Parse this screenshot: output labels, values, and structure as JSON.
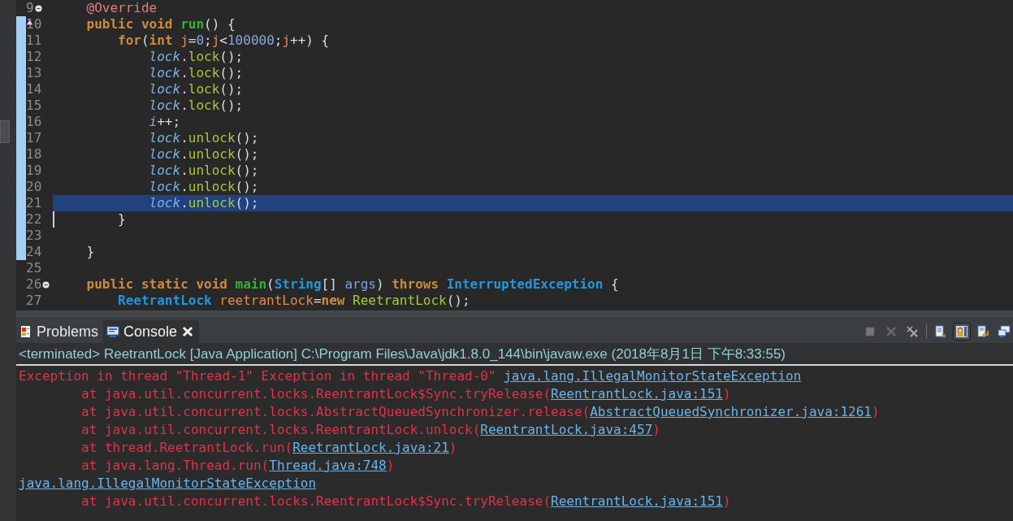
{
  "editor": {
    "lines": [
      {
        "number": "9",
        "changed": false,
        "current": false,
        "cursor": false,
        "fold": true,
        "override": false,
        "tokens": [
          {
            "kind": "annotation",
            "text": "    @Override"
          }
        ]
      },
      {
        "number": "10",
        "changed": true,
        "current": false,
        "cursor": false,
        "fold": false,
        "override": true,
        "tokens": [
          {
            "kind": "keyword",
            "text": "    public void "
          },
          {
            "kind": "declaration",
            "text": "run"
          },
          {
            "kind": "plain",
            "text": "() {"
          }
        ]
      },
      {
        "number": "11",
        "changed": true,
        "current": false,
        "cursor": false,
        "fold": false,
        "override": false,
        "tokens": [
          {
            "kind": "keyword",
            "text": "        for"
          },
          {
            "kind": "plain",
            "text": "("
          },
          {
            "kind": "keyword",
            "text": "int "
          },
          {
            "kind": "local",
            "text": "j"
          },
          {
            "kind": "plain",
            "text": "="
          },
          {
            "kind": "number",
            "text": "0"
          },
          {
            "kind": "plain",
            "text": ";"
          },
          {
            "kind": "local",
            "text": "j"
          },
          {
            "kind": "plain",
            "text": "<"
          },
          {
            "kind": "number",
            "text": "100000"
          },
          {
            "kind": "plain",
            "text": ";"
          },
          {
            "kind": "local",
            "text": "j"
          },
          {
            "kind": "plain",
            "text": "++) {"
          }
        ]
      },
      {
        "number": "12",
        "changed": true,
        "current": false,
        "cursor": false,
        "fold": false,
        "override": false,
        "tokens": [
          {
            "kind": "field",
            "text": "            lock"
          },
          {
            "kind": "plain",
            "text": "."
          },
          {
            "kind": "call",
            "text": "lock"
          },
          {
            "kind": "plain",
            "text": "();"
          }
        ]
      },
      {
        "number": "13",
        "changed": true,
        "current": false,
        "cursor": false,
        "fold": false,
        "override": false,
        "tokens": [
          {
            "kind": "field",
            "text": "            lock"
          },
          {
            "kind": "plain",
            "text": "."
          },
          {
            "kind": "call",
            "text": "lock"
          },
          {
            "kind": "plain",
            "text": "();"
          }
        ]
      },
      {
        "number": "14",
        "changed": true,
        "current": false,
        "cursor": false,
        "fold": false,
        "override": false,
        "tokens": [
          {
            "kind": "field",
            "text": "            lock"
          },
          {
            "kind": "plain",
            "text": "."
          },
          {
            "kind": "call",
            "text": "lock"
          },
          {
            "kind": "plain",
            "text": "();"
          }
        ]
      },
      {
        "number": "15",
        "changed": true,
        "current": false,
        "cursor": false,
        "fold": false,
        "override": false,
        "tokens": [
          {
            "kind": "field",
            "text": "            lock"
          },
          {
            "kind": "plain",
            "text": "."
          },
          {
            "kind": "call",
            "text": "lock"
          },
          {
            "kind": "plain",
            "text": "();"
          }
        ]
      },
      {
        "number": "16",
        "changed": true,
        "current": false,
        "cursor": false,
        "fold": false,
        "override": false,
        "tokens": [
          {
            "kind": "field",
            "text": "            i"
          },
          {
            "kind": "plain",
            "text": "++;"
          }
        ]
      },
      {
        "number": "17",
        "changed": true,
        "current": false,
        "cursor": false,
        "fold": false,
        "override": false,
        "tokens": [
          {
            "kind": "field",
            "text": "            lock"
          },
          {
            "kind": "plain",
            "text": "."
          },
          {
            "kind": "call",
            "text": "unlock"
          },
          {
            "kind": "plain",
            "text": "();"
          }
        ]
      },
      {
        "number": "18",
        "changed": true,
        "current": false,
        "cursor": false,
        "fold": false,
        "override": false,
        "tokens": [
          {
            "kind": "field",
            "text": "            lock"
          },
          {
            "kind": "plain",
            "text": "."
          },
          {
            "kind": "call",
            "text": "unlock"
          },
          {
            "kind": "plain",
            "text": "();"
          }
        ]
      },
      {
        "number": "19",
        "changed": true,
        "current": false,
        "cursor": false,
        "fold": false,
        "override": false,
        "tokens": [
          {
            "kind": "field",
            "text": "            lock"
          },
          {
            "kind": "plain",
            "text": "."
          },
          {
            "kind": "call",
            "text": "unlock"
          },
          {
            "kind": "plain",
            "text": "();"
          }
        ]
      },
      {
        "number": "20",
        "changed": true,
        "current": false,
        "cursor": false,
        "fold": false,
        "override": false,
        "tokens": [
          {
            "kind": "field",
            "text": "            lock"
          },
          {
            "kind": "plain",
            "text": "."
          },
          {
            "kind": "call",
            "text": "unlock"
          },
          {
            "kind": "plain",
            "text": "();"
          }
        ]
      },
      {
        "number": "21",
        "changed": true,
        "current": true,
        "cursor": false,
        "fold": false,
        "override": false,
        "tokens": [
          {
            "kind": "field",
            "text": "            lock"
          },
          {
            "kind": "plain",
            "text": "."
          },
          {
            "kind": "call",
            "text": "unlock"
          },
          {
            "kind": "plain",
            "text": "();"
          }
        ]
      },
      {
        "number": "22",
        "changed": true,
        "current": false,
        "cursor": true,
        "fold": false,
        "override": false,
        "tokens": [
          {
            "kind": "plain",
            "text": "        }"
          }
        ]
      },
      {
        "number": "23",
        "changed": true,
        "current": false,
        "cursor": false,
        "fold": false,
        "override": false
      },
      {
        "number": "24",
        "changed": true,
        "current": false,
        "cursor": false,
        "fold": false,
        "override": false,
        "tokens": [
          {
            "kind": "plain",
            "text": "    }"
          }
        ]
      },
      {
        "number": "25",
        "changed": false,
        "current": false,
        "cursor": false,
        "fold": false,
        "override": false
      },
      {
        "number": "26",
        "changed": false,
        "current": false,
        "cursor": false,
        "fold": true,
        "override": false,
        "tokens": [
          {
            "kind": "keyword",
            "text": "    public static void "
          },
          {
            "kind": "declaration",
            "text": "main"
          },
          {
            "kind": "plain",
            "text": "("
          },
          {
            "kind": "type",
            "text": "String"
          },
          {
            "kind": "plain",
            "text": "[] "
          },
          {
            "kind": "param",
            "text": "args"
          },
          {
            "kind": "plain",
            "text": ") "
          },
          {
            "kind": "keyword",
            "text": "throws "
          },
          {
            "kind": "type",
            "text": "InterruptedException"
          },
          {
            "kind": "plain",
            "text": " {"
          }
        ]
      },
      {
        "number": "27",
        "changed": false,
        "current": false,
        "cursor": false,
        "fold": false,
        "override": false,
        "tokens": [
          {
            "kind": "type",
            "text": "        ReetrantLock"
          },
          {
            "kind": "local",
            "text": " reetrantLock"
          },
          {
            "kind": "plain",
            "text": "="
          },
          {
            "kind": "keyword",
            "text": "new "
          },
          {
            "kind": "call",
            "text": "ReetrantLock"
          },
          {
            "kind": "plain",
            "text": "();"
          }
        ]
      }
    ]
  },
  "views": {
    "tabs": [
      {
        "kind": "problems",
        "label": "Problems",
        "selected": false,
        "closable": false
      },
      {
        "kind": "console",
        "label": "Console",
        "selected": true,
        "closable": true
      }
    ],
    "toolbar": [
      {
        "kind": "terminate",
        "disabled": true,
        "selected": false
      },
      {
        "kind": "remove",
        "disabled": true,
        "selected": false
      },
      {
        "kind": "remove-all",
        "disabled": false,
        "selected": false
      },
      {
        "kind": "clear",
        "disabled": false,
        "selected": false
      },
      {
        "kind": "scroll-lock",
        "disabled": false,
        "selected": true
      },
      {
        "kind": "word-wrap",
        "disabled": false,
        "selected": false
      },
      {
        "kind": "display",
        "disabled": false,
        "selected": false
      }
    ],
    "console": {
      "header": "<terminated> ReetrantLock [Java Application] C:\\Program Files\\Java\\jdk1.8.0_144\\bin\\javaw.exe (2018年8月1日 下午8:33:55)",
      "lines": [
        [
          {
            "kind": "text",
            "text": "Exception in thread \"Thread-1\" Exception in thread \"Thread-0\" "
          },
          {
            "kind": "link",
            "text": "java.lang.IllegalMonitorStateException"
          }
        ],
        [
          {
            "kind": "text",
            "text": "\tat java.util.concurrent.locks.ReentrantLock$Sync.tryRelease("
          },
          {
            "kind": "link",
            "text": "ReentrantLock.java:151"
          },
          {
            "kind": "text",
            "text": ")"
          }
        ],
        [
          {
            "kind": "text",
            "text": "\tat java.util.concurrent.locks.AbstractQueuedSynchronizer.release("
          },
          {
            "kind": "link",
            "text": "AbstractQueuedSynchronizer.java:1261"
          },
          {
            "kind": "text",
            "text": ")"
          }
        ],
        [
          {
            "kind": "text",
            "text": "\tat java.util.concurrent.locks.ReentrantLock.unlock("
          },
          {
            "kind": "link",
            "text": "ReentrantLock.java:457"
          },
          {
            "kind": "text",
            "text": ")"
          }
        ],
        [
          {
            "kind": "text",
            "text": "\tat thread.ReetrantLock.run("
          },
          {
            "kind": "link",
            "text": "ReetrantLock.java:21"
          },
          {
            "kind": "text",
            "text": ")"
          }
        ],
        [
          {
            "kind": "text",
            "text": "\tat java.lang.Thread.run("
          },
          {
            "kind": "link",
            "text": "Thread.java:748"
          },
          {
            "kind": "text",
            "text": ")"
          }
        ],
        [
          {
            "kind": "link",
            "text": "java.lang.IllegalMonitorStateException"
          }
        ],
        [
          {
            "kind": "text",
            "text": "\tat java.util.concurrent.locks.ReentrantLock$Sync.tryRelease("
          },
          {
            "kind": "link",
            "text": "ReentrantLock.java:151"
          },
          {
            "kind": "text",
            "text": ")"
          }
        ]
      ]
    }
  }
}
